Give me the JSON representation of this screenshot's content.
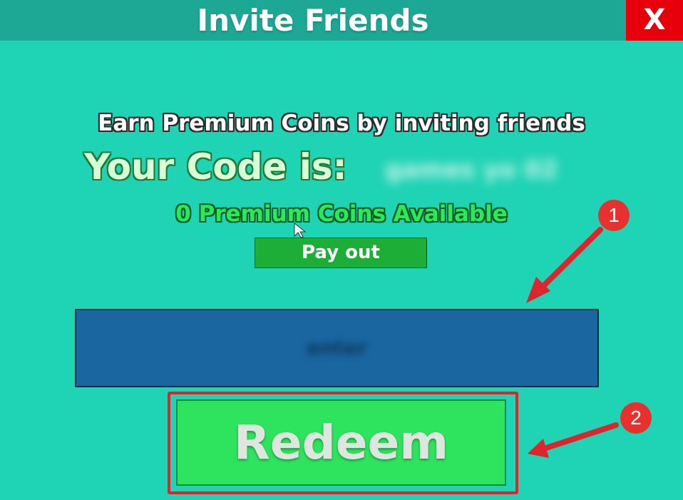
{
  "window": {
    "title": "Invite Friends",
    "close_label": "X"
  },
  "main": {
    "earn_text": "Earn Premium Coins by inviting friends",
    "code_label": "Your Code is:",
    "code_value": "games yo 02",
    "coins_available": "0 Premium Coins Available",
    "payout_label": "Pay out",
    "code_input_value": "enter",
    "redeem_label": "Redeem"
  },
  "annotations": {
    "step1": "1",
    "step2": "2"
  },
  "colors": {
    "background": "#1fd3b5",
    "titlebar": "#1ca894",
    "close": "#e7000b",
    "payout": "#1cae36",
    "input": "#1a66a0",
    "redeem": "#2ee35d",
    "annotation_red": "#e0242b"
  }
}
